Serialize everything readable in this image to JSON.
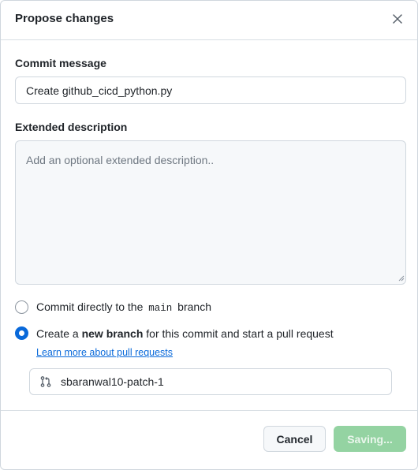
{
  "dialog": {
    "title": "Propose changes",
    "close_icon": "close-icon"
  },
  "commit_message": {
    "label": "Commit message",
    "value": "Create github_cicd_python.py"
  },
  "extended_description": {
    "label": "Extended description",
    "placeholder": "Add an optional extended description.."
  },
  "options": {
    "direct": {
      "prefix": "Commit directly to the",
      "branch_code": "main",
      "suffix": "branch",
      "checked": false
    },
    "new_branch": {
      "prefix": "Create a",
      "bold": "new branch",
      "suffix": "for this commit and start a pull request",
      "checked": true,
      "link": "Learn more about pull requests"
    }
  },
  "branch_name": {
    "icon": "git-pull-request-icon",
    "value": "sbaranwal10-patch-1"
  },
  "footer": {
    "cancel_label": "Cancel",
    "submit_label": "Saving..."
  },
  "colors": {
    "accent": "#0969da",
    "submit_disabled": "#94d3a2"
  }
}
